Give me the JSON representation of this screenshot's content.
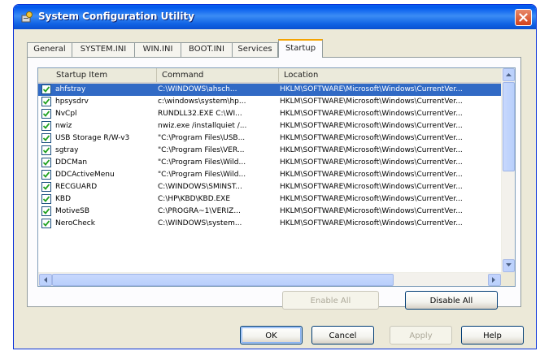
{
  "window": {
    "title": "System Configuration Utility",
    "accent": "#0058ee"
  },
  "tabs": [
    {
      "label": "General",
      "active": false
    },
    {
      "label": "SYSTEM.INI",
      "active": false
    },
    {
      "label": "WIN.INI",
      "active": false
    },
    {
      "label": "BOOT.INI",
      "active": false
    },
    {
      "label": "Services",
      "active": false
    },
    {
      "label": "Startup",
      "active": true
    }
  ],
  "list": {
    "columns": [
      "Startup Item",
      "Command",
      "Location"
    ],
    "rows": [
      {
        "checked": true,
        "item": "ahfstray",
        "command": "C:\\WINDOWS\\ahsch...",
        "location": "HKLM\\SOFTWARE\\Microsoft\\Windows\\CurrentVer..."
      },
      {
        "checked": true,
        "item": "hpsysdrv",
        "command": "c:\\windows\\system\\hp...",
        "location": "HKLM\\SOFTWARE\\Microsoft\\Windows\\CurrentVer..."
      },
      {
        "checked": true,
        "item": "NvCpl",
        "command": "RUNDLL32.EXE C:\\WI...",
        "location": "HKLM\\SOFTWARE\\Microsoft\\Windows\\CurrentVer..."
      },
      {
        "checked": true,
        "item": "nwiz",
        "command": "nwiz.exe /installquiet /...",
        "location": "HKLM\\SOFTWARE\\Microsoft\\Windows\\CurrentVer..."
      },
      {
        "checked": true,
        "item": "USB Storage R/W-v3",
        "command": "\"C:\\Program Files\\USB...",
        "location": "HKLM\\SOFTWARE\\Microsoft\\Windows\\CurrentVer..."
      },
      {
        "checked": true,
        "item": "sgtray",
        "command": "\"C:\\Program Files\\VER...",
        "location": "HKLM\\SOFTWARE\\Microsoft\\Windows\\CurrentVer..."
      },
      {
        "checked": true,
        "item": "DDCMan",
        "command": "\"C:\\Program Files\\Wild...",
        "location": "HKLM\\SOFTWARE\\Microsoft\\Windows\\CurrentVer..."
      },
      {
        "checked": true,
        "item": "DDCActiveMenu",
        "command": "\"C:\\Program Files\\Wild...",
        "location": "HKLM\\SOFTWARE\\Microsoft\\Windows\\CurrentVer..."
      },
      {
        "checked": true,
        "item": "RECGUARD",
        "command": "C:\\WINDOWS\\SMINST...",
        "location": "HKLM\\SOFTWARE\\Microsoft\\Windows\\CurrentVer..."
      },
      {
        "checked": true,
        "item": "KBD",
        "command": "C:\\HP\\KBD\\KBD.EXE",
        "location": "HKLM\\SOFTWARE\\Microsoft\\Windows\\CurrentVer..."
      },
      {
        "checked": true,
        "item": "MotiveSB",
        "command": "C:\\PROGRA~1\\VERIZ...",
        "location": "HKLM\\SOFTWARE\\Microsoft\\Windows\\CurrentVer..."
      },
      {
        "checked": true,
        "item": "NeroCheck",
        "command": "C:\\WINDOWS\\system...",
        "location": "HKLM\\SOFTWARE\\Microsoft\\Windows\\CurrentVer..."
      }
    ],
    "selected_index": 0
  },
  "buttons": {
    "enable_all": "Enable All",
    "disable_all": "Disable All",
    "ok": "OK",
    "cancel": "Cancel",
    "apply": "Apply",
    "help": "Help"
  }
}
